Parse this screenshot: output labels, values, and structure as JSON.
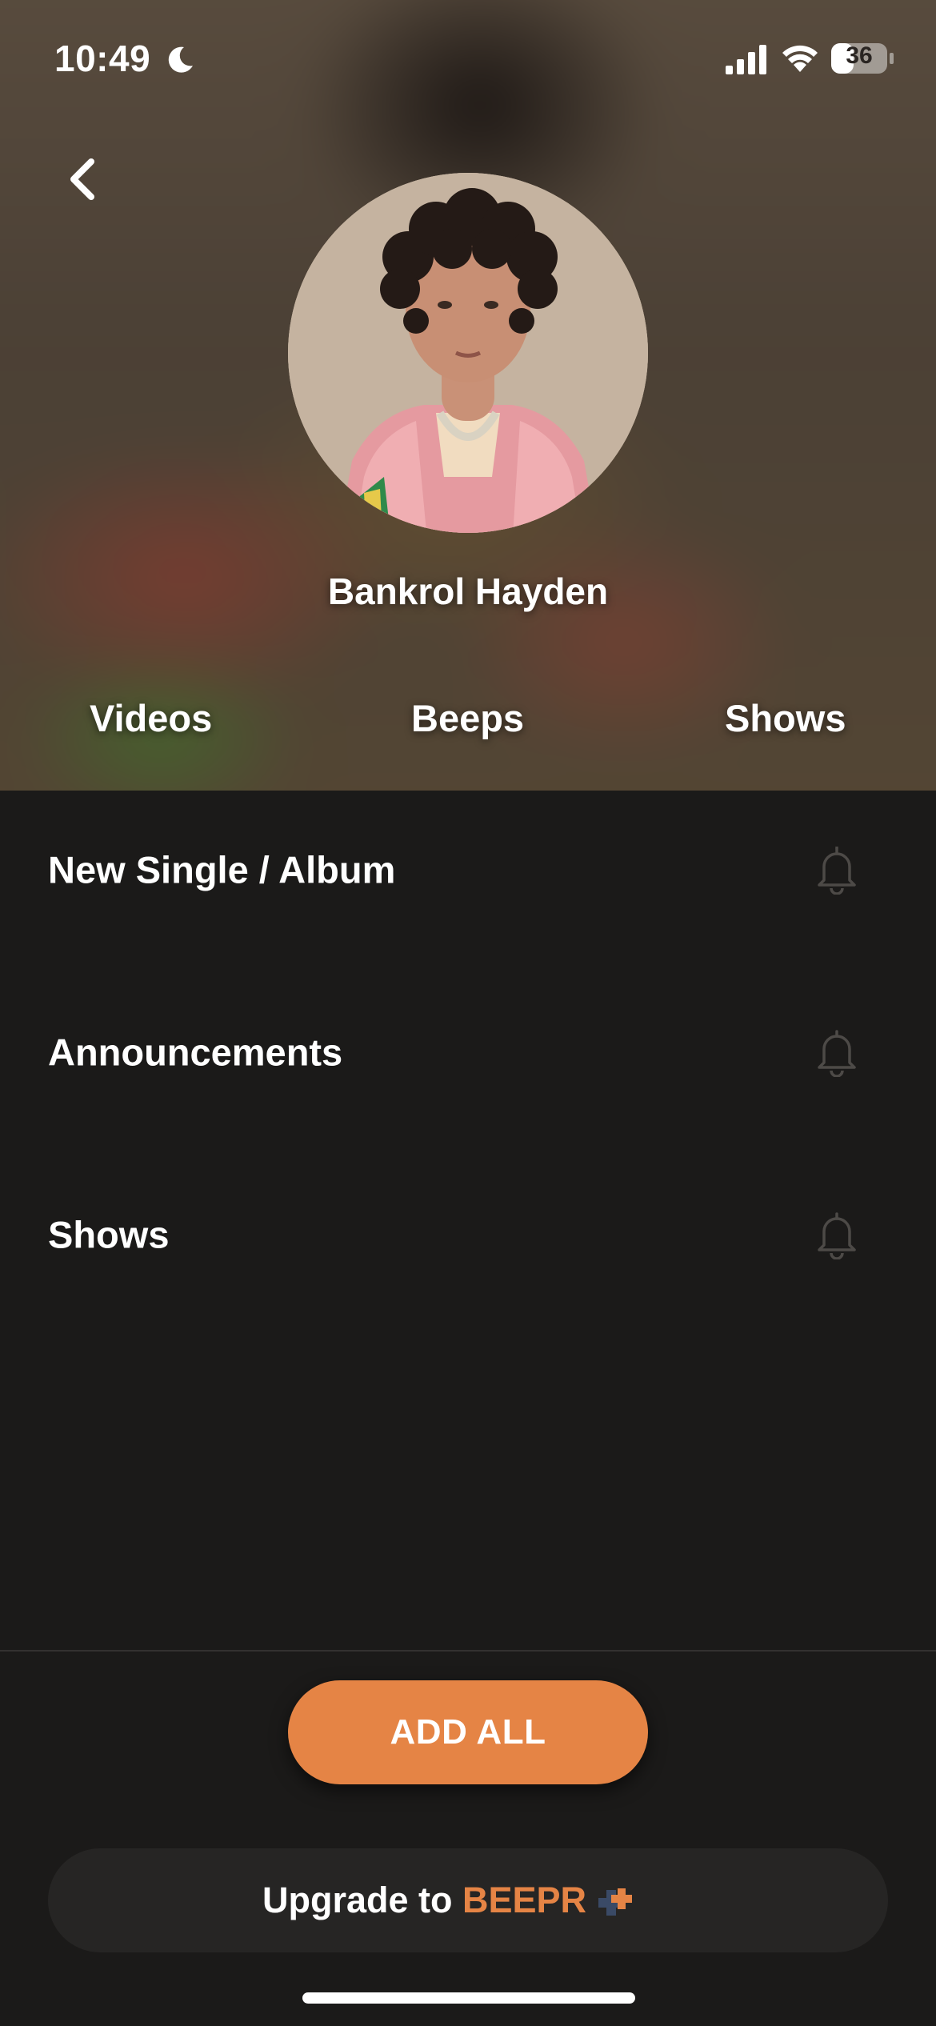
{
  "status_bar": {
    "time": "10:49",
    "battery": "36",
    "icons": [
      "moon-icon",
      "signal-icon",
      "wifi-icon",
      "battery-icon"
    ]
  },
  "header": {
    "back_icon": "chevron-left-icon",
    "artist_name": "Bankrol Hayden",
    "tabs": [
      {
        "label": "Videos"
      },
      {
        "label": "Beeps"
      },
      {
        "label": "Shows"
      }
    ]
  },
  "notifications": {
    "items": [
      {
        "label": "New Single / Album",
        "icon": "bell-icon"
      },
      {
        "label": "Announcements",
        "icon": "bell-icon"
      },
      {
        "label": "Shows",
        "icon": "bell-icon"
      }
    ]
  },
  "actions": {
    "add_all_label": "ADD ALL",
    "upgrade_prefix": "Upgrade to ",
    "upgrade_brand": "BEEPR",
    "upgrade_icon": "plus-icon"
  },
  "colors": {
    "accent": "#e58445",
    "background": "#1b1a19",
    "upgrade_bar": "#262524"
  }
}
